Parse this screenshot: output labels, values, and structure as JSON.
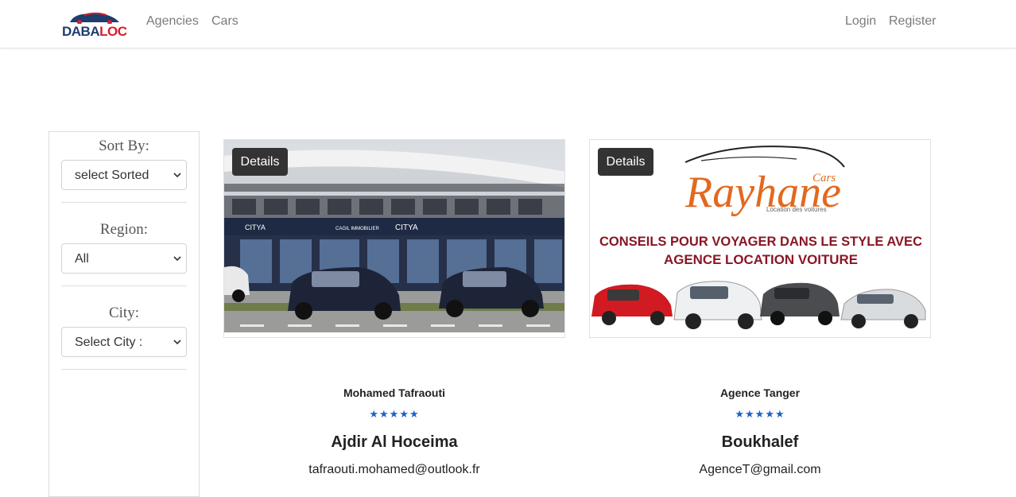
{
  "brand": {
    "logo_text_1": "DABA",
    "logo_text_2": "LOC",
    "color_navy": "#1f3d6e",
    "color_red": "#d6202b"
  },
  "nav": {
    "links": [
      "Agencies",
      "Cars"
    ],
    "right": [
      "Login",
      "Register"
    ]
  },
  "filters": {
    "sort": {
      "title": "Sort By:",
      "value": "select Sorted"
    },
    "region": {
      "title": "Region:",
      "value": "All"
    },
    "city": {
      "title": "City:",
      "value": "Select City :"
    }
  },
  "cards": [
    {
      "details_label": "Details",
      "owner": "Mohamed Tafraouti",
      "rating": "★★★★★",
      "name": "Ajdir Al Hoceima",
      "email": "tafraouti.mohamed@outlook.fr",
      "storefront_signs": [
        "CITYA",
        "CAGIL IMMOBILIER",
        "CITYA"
      ]
    },
    {
      "details_label": "Details",
      "owner": "Agence Tanger",
      "rating": "★★★★★",
      "name": "Boukhalef",
      "email": "AgenceT@gmail.com",
      "banner": {
        "brand_script": "Rayhane",
        "brand_small": "Cars",
        "tagline": "Location des voitures",
        "headline_1": "CONSEILS POUR VOYAGER DANS LE STYLE AVEC",
        "headline_2": "AGENCE LOCATION VOITURE"
      }
    }
  ],
  "accent": {
    "star_color": "#1a64c8",
    "button_bg": "#333333"
  }
}
